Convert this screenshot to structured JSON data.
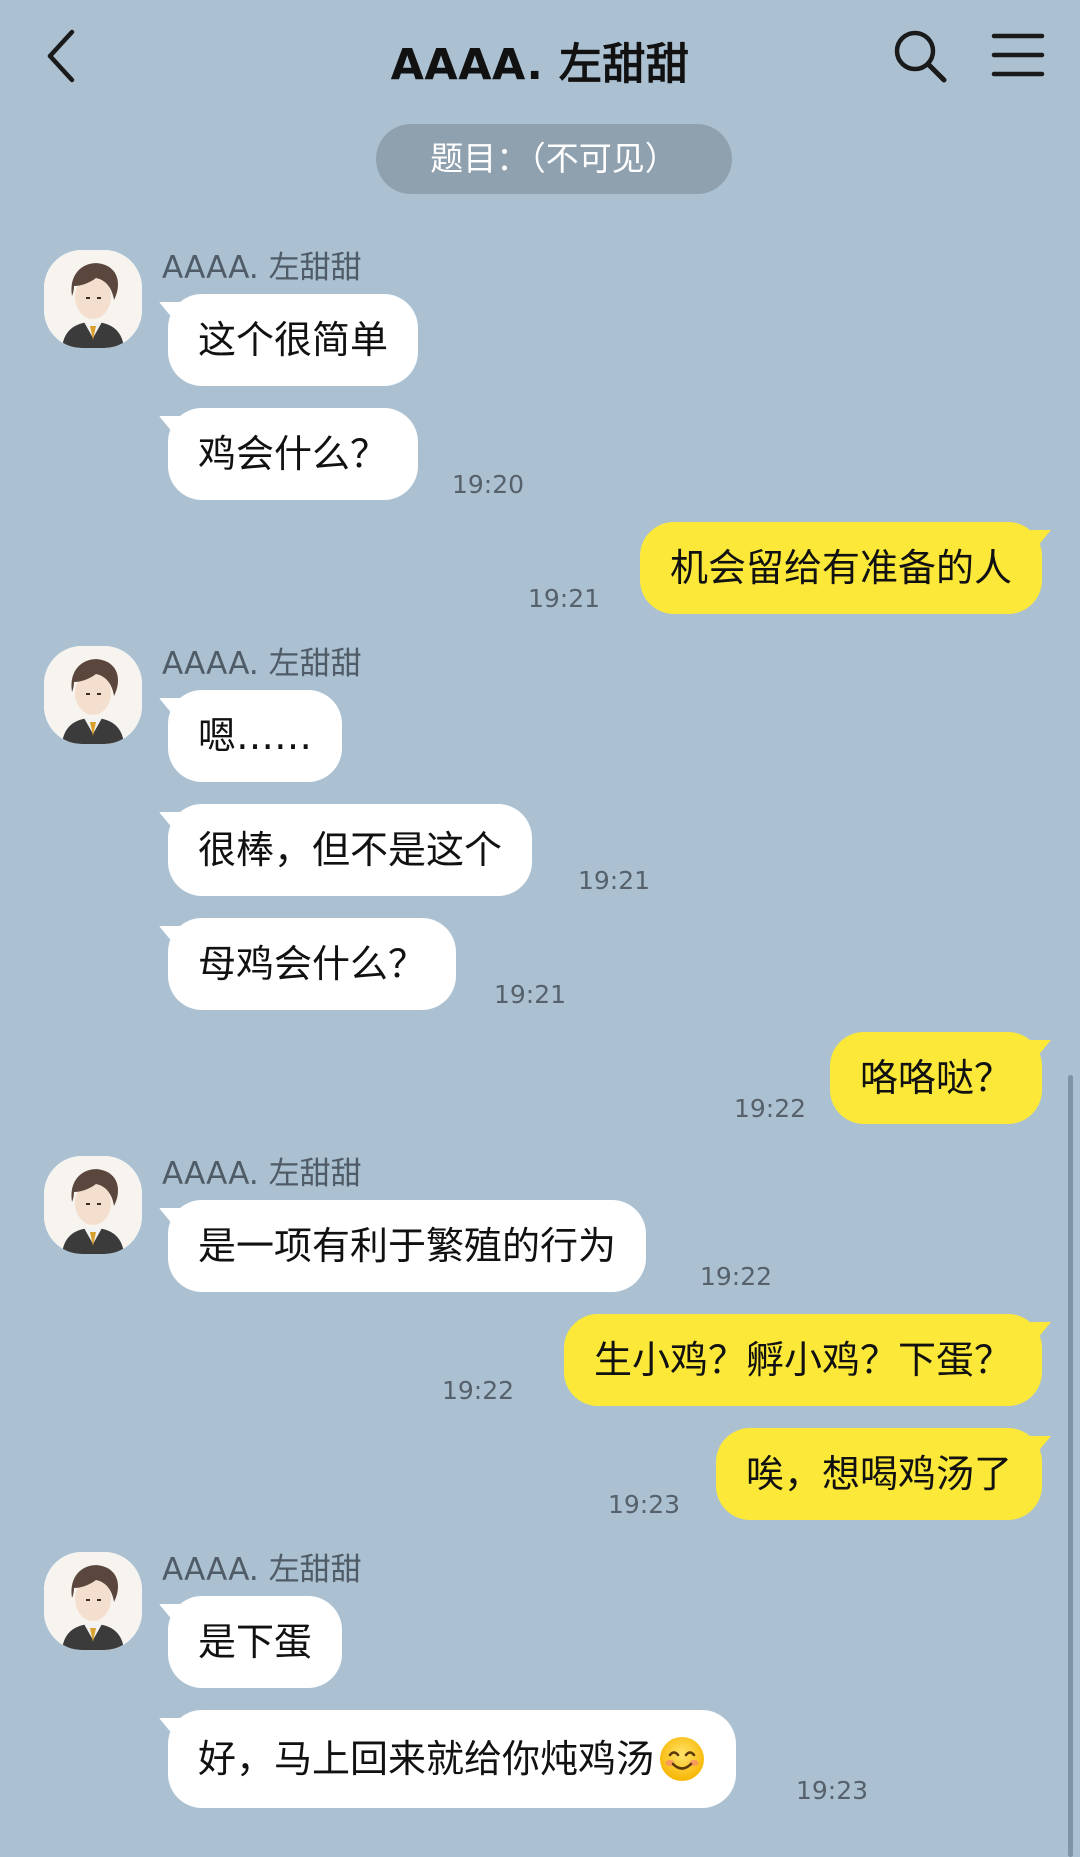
{
  "header": {
    "title": "AAAA. 左甜甜",
    "back_icon": "chevron-left-icon",
    "search_icon": "search-icon",
    "menu_icon": "hamburger-menu-icon"
  },
  "notice": "题目：（不可见）",
  "colors": {
    "background": "#abc1d2",
    "incoming_bubble": "#ffffff",
    "outgoing_bubble": "#fbe839",
    "notice_pill": "#8fa1af"
  },
  "messages": [
    {
      "sender": "AAAA. 左甜甜",
      "text": "这个很简单",
      "time": "",
      "from": "contact"
    },
    {
      "text": "鸡会什么？",
      "time": "19:20",
      "from": "contact"
    },
    {
      "text": "机会留给有准备的人",
      "time": "19:21",
      "from": "me"
    },
    {
      "sender": "AAAA. 左甜甜",
      "text": "嗯……",
      "time": "",
      "from": "contact"
    },
    {
      "text": "很棒，但不是这个",
      "time": "19:21",
      "from": "contact"
    },
    {
      "text": "母鸡会什么？",
      "time": "19:21",
      "from": "contact"
    },
    {
      "text": "咯咯哒？",
      "time": "19:22",
      "from": "me"
    },
    {
      "sender": "AAAA. 左甜甜",
      "text": "是一项有利于繁殖的行为",
      "time": "19:22",
      "from": "contact"
    },
    {
      "text": "生小鸡？孵小鸡？下蛋？",
      "time": "19:22",
      "from": "me"
    },
    {
      "text": "唉，想喝鸡汤了",
      "time": "19:23",
      "from": "me"
    },
    {
      "sender": "AAAA. 左甜甜",
      "text": "是下蛋",
      "time": "",
      "from": "contact"
    },
    {
      "text": "好，马上回来就给你炖鸡汤",
      "emoji": "smiling-face-emoji",
      "time": "19:23",
      "from": "contact"
    }
  ]
}
